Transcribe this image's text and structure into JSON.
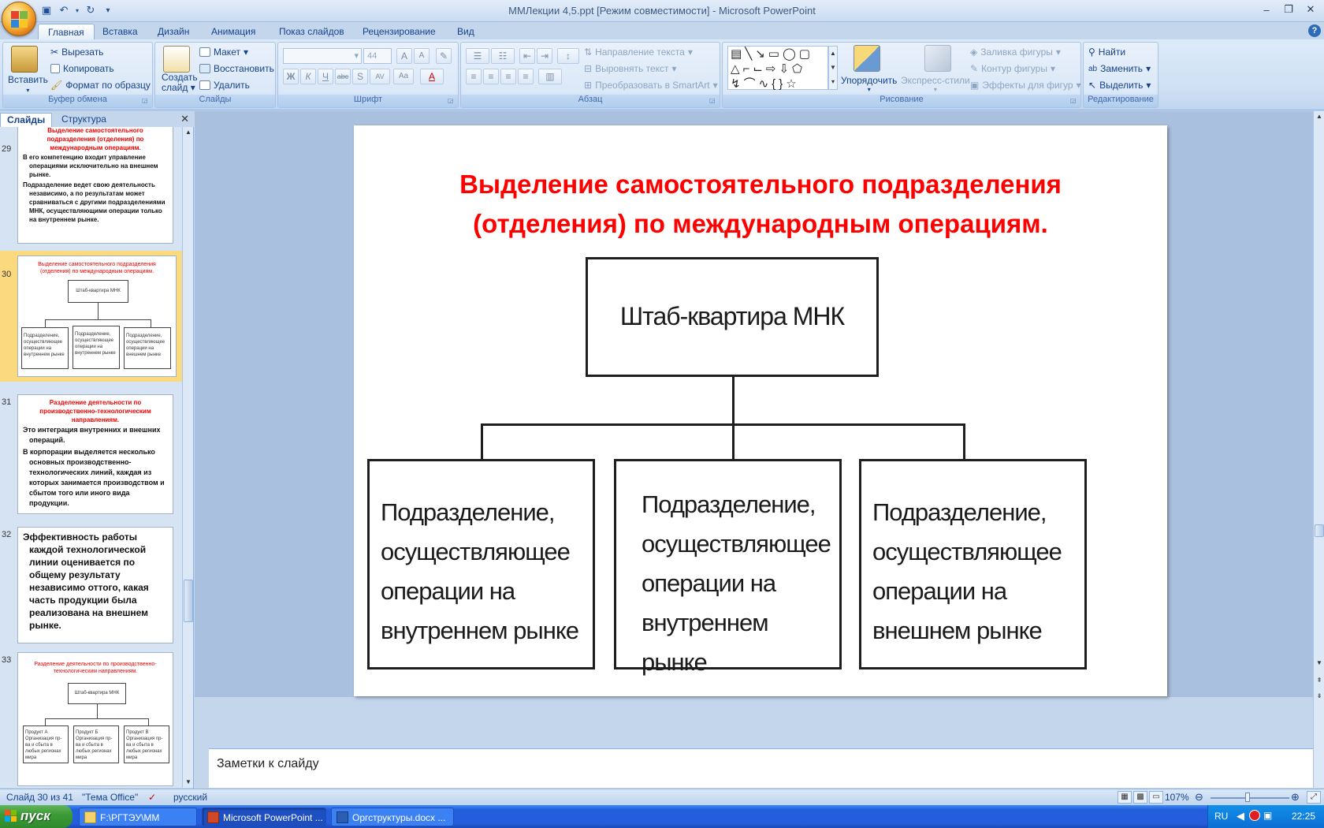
{
  "window": {
    "title": "ММЛекции 4,5.ppt [Режим совместимости] - Microsoft PowerPoint"
  },
  "ribbon_tabs": [
    "Главная",
    "Вставка",
    "Дизайн",
    "Анимация",
    "Показ слайдов",
    "Рецензирование",
    "Вид"
  ],
  "active_tab": "Главная",
  "clipboard": {
    "paste": "Вставить",
    "cut": "Вырезать",
    "copy": "Копировать",
    "format_painter": "Формат по образцу",
    "label": "Буфер обмена"
  },
  "slides_group": {
    "new_slide_line1": "Создать",
    "new_slide_line2": "слайд",
    "layout": "Макет",
    "reset": "Восстановить",
    "delete": "Удалить",
    "label": "Слайды"
  },
  "font_group": {
    "font_size": "44",
    "label": "Шрифт",
    "buttons": [
      "Ж",
      "К",
      "Ч",
      "abc",
      "S",
      "AV",
      "Aa",
      "A"
    ]
  },
  "paragraph_group": {
    "text_direction": "Направление текста",
    "align_text": "Выровнять текст",
    "smartart": "Преобразовать в SmartArt",
    "label": "Абзац"
  },
  "drawing_group": {
    "arrange": "Упорядочить",
    "quick_styles": "Экспресс-стили",
    "shape_fill": "Заливка фигуры",
    "shape_outline": "Контур фигуры",
    "shape_effects": "Эффекты для фигур",
    "label": "Рисование"
  },
  "editing_group": {
    "find": "Найти",
    "replace": "Заменить",
    "select": "Выделить",
    "label": "Редактирование"
  },
  "panel": {
    "tab_slides": "Слайды",
    "tab_outline": "Структура"
  },
  "thumbnails": {
    "s29": {
      "num": "29",
      "title": "Выделение самостоятельного подразделения (отделения) по международным операциям.",
      "p1": "В его компетенцию входит управление операциями исключительно на внешнем рынке.",
      "p2": "Подразделение ведет свою деятельность независимо, а по результатам может сравниваться с другими подразделениями МНК, осуществляющими операции только на внутреннем рынке."
    },
    "s30": {
      "num": "30",
      "title": "Выделение самостоятельного подразделения (отделения) по международным операциям.",
      "hq": "Штаб-квартира МНК",
      "b1": "Подразделение, осуществляющее операции на внутреннем рынке",
      "b2": "Подразделение, осуществляющее операции на внутреннем рынке",
      "b3": "Подразделение, осуществляющее операции на внешнем рынке"
    },
    "s31": {
      "num": "31",
      "title": "Разделение деятельности по производственно-технологическим направлениям.",
      "p1": "Это интеграция внутренних и внешних операций.",
      "p2": "В корпорации выделяется несколько основных производственно-технологических линий, каждая из которых занимается производством и сбытом того или иного вида продукции."
    },
    "s32": {
      "num": "32",
      "p1": "Эффективность работы каждой технологической линии оценивается по общему результату независимо оттого, какая часть продукции была реализована на внешнем рынке."
    },
    "s33": {
      "num": "33",
      "title": "Разделение деятельности по производственно-технологическим направлениям.",
      "hq": "Штаб-квартира МНК",
      "b1": "Продукт А Организация пр-ва и сбыта в любых регионах мира",
      "b2": "Продукт Б Организация пр-ва и сбыта в любых регионах мира",
      "b3": "Продукт В Организация пр-ва и сбыта в любых регионах мира"
    }
  },
  "slide": {
    "title": "Выделение самостоятельного подразделения (отделения) по международным операциям.",
    "hq": "Штаб-квартира МНК",
    "box1": "Подразделение, осуществляющее операции на внутреннем рынке",
    "box2": "Подразделение, осуществляющее операции на внутреннем рынке",
    "box3": "Подразделение, осуществляющее операции на внешнем рынке"
  },
  "notes": {
    "placeholder": "Заметки к слайду"
  },
  "status": {
    "slide_counter": "Слайд 30 из 41",
    "theme": "\"Тема Office\"",
    "language": "русский",
    "zoom": "107%"
  },
  "taskbar": {
    "start": "пуск",
    "tasks": [
      "F:\\РГТЭУ\\ММ",
      "Microsoft PowerPoint ...",
      "Оргструктуры.docx ..."
    ],
    "lang": "RU",
    "clock": "22:25"
  },
  "colors": {
    "slide_title": "#ff0000",
    "accent": "#15428b",
    "selected_thumb": "#f7c55a"
  }
}
